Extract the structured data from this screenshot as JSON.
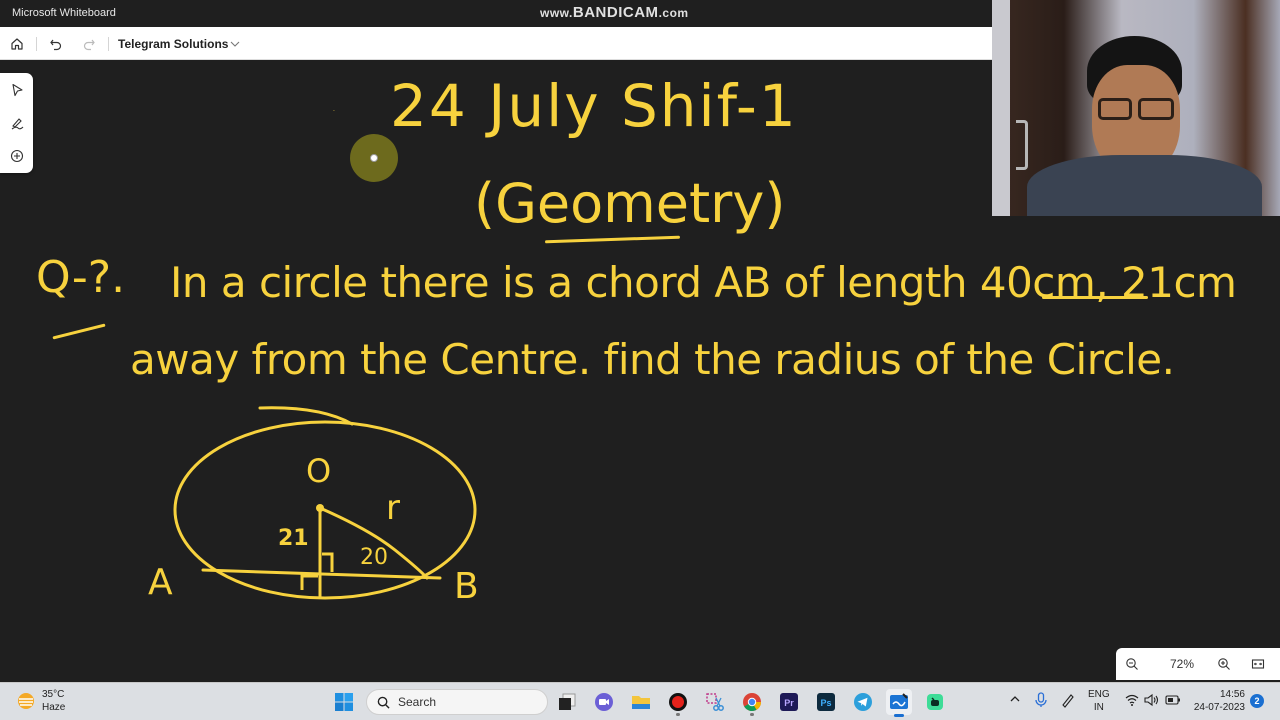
{
  "window": {
    "app_title": "Microsoft Whiteboard",
    "watermark_prefix": "www.",
    "watermark_brand": "BANDICAM",
    "watermark_suffix": ".com"
  },
  "toolbar": {
    "home_icon": "home-icon",
    "undo_icon": "undo-icon",
    "redo_icon": "redo-icon",
    "board_name": "Telegram Solutions",
    "board_menu_icon": "chevron-down-icon"
  },
  "tools": [
    {
      "name": "select",
      "icon": "cursor-icon"
    },
    {
      "name": "ink",
      "icon": "pen-icon"
    },
    {
      "name": "insert",
      "icon": "plus-circle-icon"
    }
  ],
  "whiteboard": {
    "ink_color": "#f7d23e",
    "heading_line1": "24 July  Shif-1",
    "heading_line2": "(Geometry)",
    "question_label": "Q-?.",
    "question_line1": "In a circle there is a chord AB of length 40cm, 21cm",
    "question_line2": "away from the Centre. find the radius of the Circle.",
    "diagram": {
      "center_label": "O",
      "radius_label": "r",
      "perpendicular_label": "21",
      "half_chord_label": "20",
      "point_a": "A",
      "point_b": "B"
    }
  },
  "zoom": {
    "zoom_out_icon": "zoom-out-icon",
    "value": "72%",
    "zoom_in_icon": "zoom-in-icon",
    "fit_icon": "fit-to-screen-icon"
  },
  "taskbar": {
    "weather_temp": "35°C",
    "weather_desc": "Haze",
    "search_placeholder": "Search",
    "apps": [
      "Start",
      "Task View",
      "Meet",
      "File Explorer",
      "Bandicam",
      "Snipping Tool",
      "Chrome",
      "Premiere Pro",
      "Photoshop",
      "Telegram",
      "Whiteboard",
      "Copilot"
    ],
    "lang_line1": "ENG",
    "lang_line2": "IN",
    "time": "14:56",
    "date": "24-07-2023",
    "notification_count": "2"
  }
}
